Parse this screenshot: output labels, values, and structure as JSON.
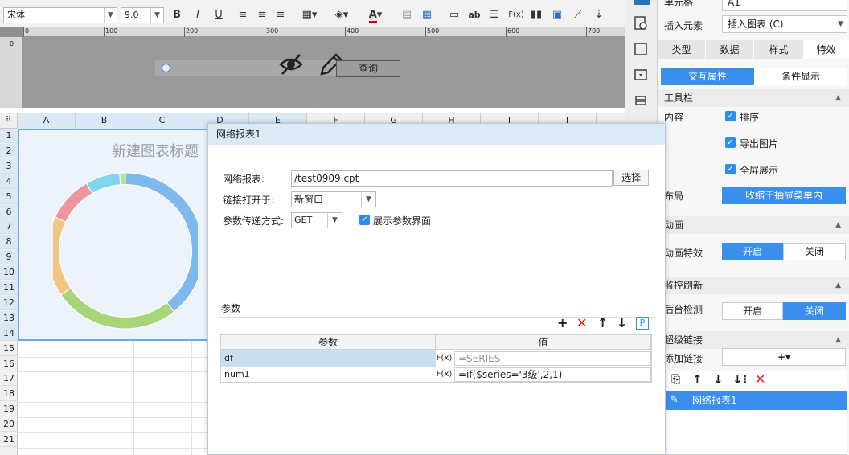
{
  "toolbar": {
    "font_name": "宋体",
    "font_size": "9.0",
    "bold": "B",
    "italic": "I",
    "underline": "U",
    "fx_label": "F(x)",
    "ab_label": "ab"
  },
  "design": {
    "ruler_ticks": [
      "0",
      "100",
      "200",
      "300",
      "400",
      "500",
      "600",
      "700"
    ],
    "v_ruler_tick": "0",
    "query_button": "查询"
  },
  "sheet": {
    "columns": [
      "A",
      "B",
      "C",
      "D",
      "E",
      "F",
      "G",
      "H",
      "I",
      "J"
    ],
    "rows": [
      "1",
      "2",
      "3",
      "4",
      "5",
      "6",
      "7",
      "8",
      "9",
      "10",
      "11",
      "12",
      "13",
      "14",
      "15",
      "16",
      "17",
      "18",
      "19",
      "20",
      "21"
    ],
    "chart_title": "新建图表标题"
  },
  "chart_data": {
    "type": "pie",
    "title": "新建图表标题",
    "slices": [
      {
        "name": "blue",
        "value": 33,
        "color": "#7fb8ec"
      },
      {
        "name": "green",
        "value": 22,
        "color": "#a9d57a"
      },
      {
        "name": "orange",
        "value": 14,
        "color": "#f2c580"
      },
      {
        "name": "red",
        "value": 8,
        "color": "#ee95a0"
      },
      {
        "name": "cyan",
        "value": 6,
        "color": "#7dd8ee"
      },
      {
        "name": "lightgreen",
        "value": 1,
        "color": "#b9e48a"
      }
    ],
    "inner_radius_ratio": 0.85
  },
  "right_panel": {
    "cell_label": "单元格",
    "cell_value": "A1",
    "insert_label": "插入元素",
    "insert_value": "插入图表 (C)",
    "tabs": [
      "类型",
      "数据",
      "样式",
      "特效"
    ],
    "active_tab": "特效",
    "sub_tabs": [
      "交互属性",
      "条件显示"
    ],
    "toolbar_section": "工具栏",
    "content_label": "内容",
    "checkboxes": [
      "排序",
      "导出图片",
      "全屏展示"
    ],
    "layout_label": "布局",
    "layout_value": "收缩于抽屉菜单内",
    "animation_section": "动画",
    "animation_label": "动画特效",
    "animation_on": "开启",
    "animation_off": "关闭",
    "monitor_section": "监控刷新",
    "monitor_label": "后台检测",
    "monitor_on": "开启",
    "monitor_off": "关闭",
    "hyperlink_section": "超级链接",
    "add_link_label": "添加链接",
    "add_link_button": "+▾",
    "link_item": "网络报表1"
  },
  "dialog": {
    "title": "网络报表1",
    "report_label": "网络报表:",
    "report_value": "/test0909.cpt",
    "select_button": "选择",
    "open_label": "链接打开于:",
    "open_value": "新窗口",
    "method_label": "参数传递方式:",
    "method_value": "GET",
    "show_params_label": "展示参数界面",
    "params_title": "参数",
    "col_param": "参数",
    "col_value": "值",
    "params": [
      {
        "name": "df",
        "value": "=SERIES"
      },
      {
        "name": "num1",
        "value": "=if($series='3级',2,1)"
      }
    ]
  },
  "colors": {
    "accent": "#3b8fec",
    "selection": "#6fa8e8",
    "dialog_title": "#dbeaf6"
  }
}
